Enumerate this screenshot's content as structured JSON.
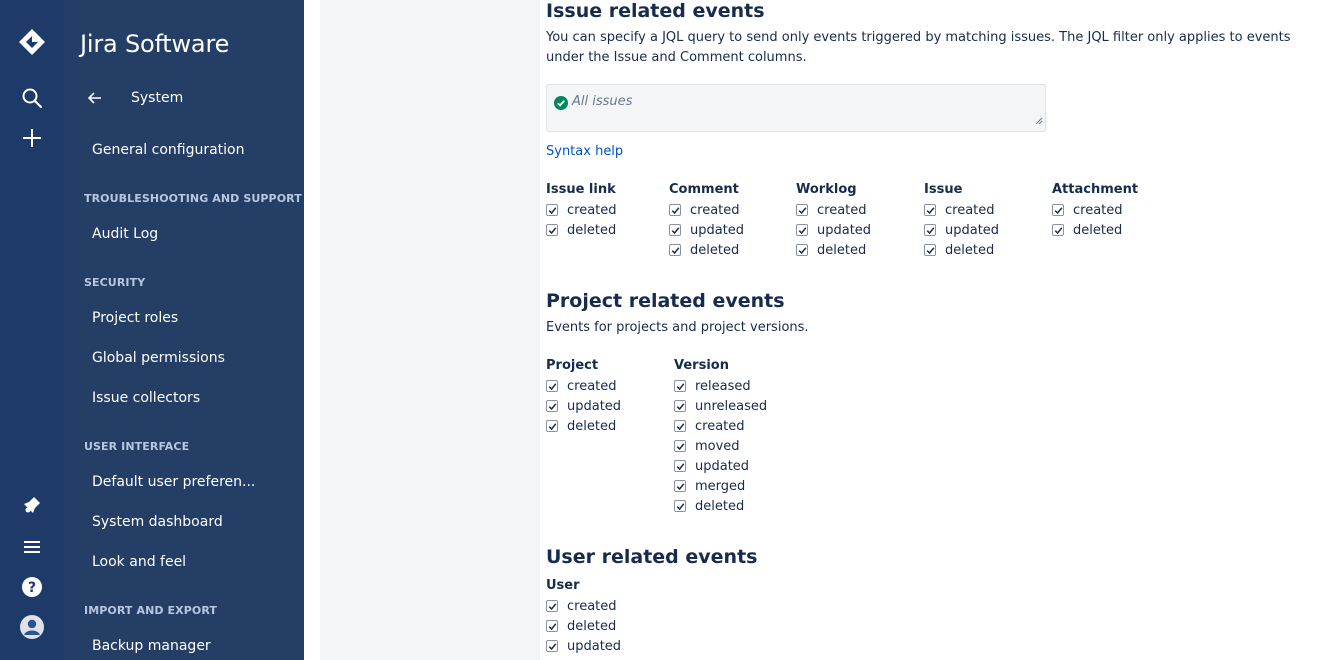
{
  "product": {
    "title": "Jira Software"
  },
  "rail": {
    "icons": [
      "jira-logo-icon",
      "search-icon",
      "plus-icon",
      "notifications-icon",
      "menu-icon",
      "help-icon",
      "avatar-icon"
    ]
  },
  "sidebar": {
    "back_label": "System",
    "general": "General configuration",
    "sections": {
      "troubleshooting": "TROUBLESHOOTING AND SUPPORT",
      "security": "SECURITY",
      "user_interface": "USER INTERFACE",
      "import_export": "IMPORT AND EXPORT"
    },
    "items": {
      "audit_log": "Audit Log",
      "project_roles": "Project roles",
      "global_permissions": "Global permissions",
      "issue_collectors": "Issue collectors",
      "default_user_prefs": "Default user preferen...",
      "system_dashboard": "System dashboard",
      "look_and_feel": "Look and feel",
      "backup_manager": "Backup manager"
    }
  },
  "issue_events": {
    "heading": "Issue related events",
    "description": "You can specify a JQL query to send only events triggered by matching issues. The JQL filter only applies to events under the Issue and Comment columns.",
    "jql_placeholder": "All issues",
    "syntax_help": "Syntax help",
    "columns": [
      {
        "title": "Issue link",
        "options": [
          "created",
          "deleted"
        ]
      },
      {
        "title": "Comment",
        "options": [
          "created",
          "updated",
          "deleted"
        ]
      },
      {
        "title": "Worklog",
        "options": [
          "created",
          "updated",
          "deleted"
        ]
      },
      {
        "title": "Issue",
        "options": [
          "created",
          "updated",
          "deleted"
        ]
      },
      {
        "title": "Attachment",
        "options": [
          "created",
          "deleted"
        ]
      }
    ]
  },
  "project_events": {
    "heading": "Project related events",
    "description": "Events for projects and project versions.",
    "columns": [
      {
        "title": "Project",
        "options": [
          "created",
          "updated",
          "deleted"
        ]
      },
      {
        "title": "Version",
        "options": [
          "released",
          "unreleased",
          "created",
          "moved",
          "updated",
          "merged",
          "deleted"
        ]
      }
    ]
  },
  "user_events": {
    "heading": "User related events",
    "columns": [
      {
        "title": "User",
        "options": [
          "created",
          "deleted",
          "updated"
        ]
      }
    ]
  },
  "colors": {
    "rail": "#1d3a68",
    "sidebar": "#243e66",
    "link": "#0052cc",
    "success": "#00875a"
  }
}
